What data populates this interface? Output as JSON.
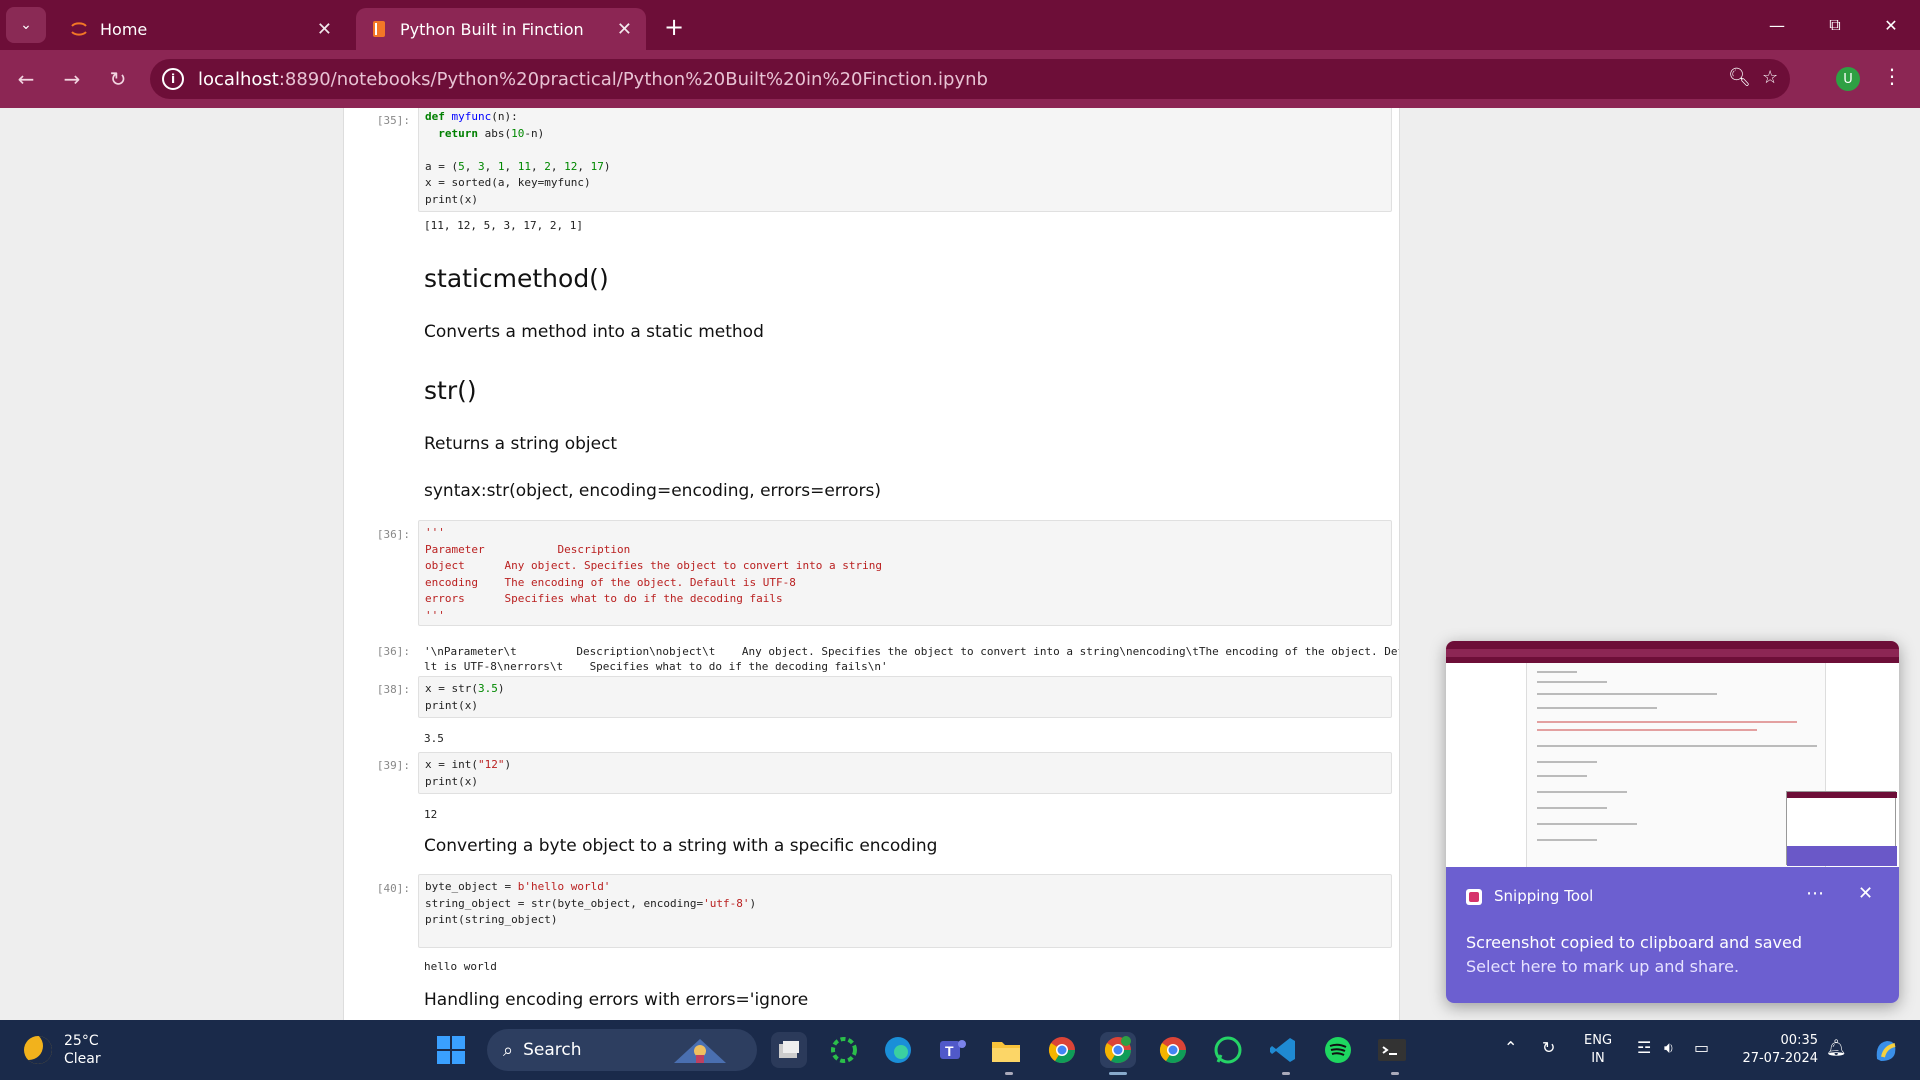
{
  "browser": {
    "tabs": [
      {
        "label": "Home",
        "active": false
      },
      {
        "label": "Python Built in Finction",
        "active": true
      }
    ],
    "new_tab": "+",
    "url_host": "localhost",
    "url_rest": ":8890/notebooks/Python%20practical/Python%20Built%20in%20Finction.ipynb",
    "profile_initial": "U",
    "theme_color": "#6d0e38",
    "accent_color": "#8c2654"
  },
  "notebook": {
    "cell35": {
      "prompt": "[35]:",
      "code_lines": [
        "def myfunc(n):",
        "  return abs(10-n)",
        "",
        "a = (5, 3, 1, 11, 2, 12, 17)",
        "x = sorted(a, key=myfunc)",
        "print(x)"
      ],
      "output": "[11, 12, 5, 3, 17, 2, 1]"
    },
    "h_staticmethod": "staticmethod()",
    "p_staticmethod": "Converts a method into a static method",
    "h_str": "str()",
    "p_str": "Returns a string object",
    "p_syntax": "syntax:str(object, encoding=encoding, errors=errors)",
    "cell36": {
      "prompt": "[36]:",
      "code_lines": [
        "'''",
        "Parameter           Description",
        "object      Any object. Specifies the object to convert into a string",
        "encoding    The encoding of the object. Default is UTF-8",
        "errors      Specifies what to do if the decoding fails",
        "'''"
      ],
      "out_prompt": "[36]:",
      "output_lines": [
        "'\\nParameter\\t         Description\\nobject\\t    Any object. Specifies the object to convert into a string\\nencoding\\tThe encoding of the object. Defau",
        "lt is UTF-8\\nerrors\\t    Specifies what to do if the decoding fails\\n'"
      ]
    },
    "cell38": {
      "prompt": "[38]:",
      "code_lines": [
        "x = str(3.5)",
        "print(x)"
      ],
      "output": "3.5"
    },
    "cell39": {
      "prompt": "[39]:",
      "code_lines": [
        "x = int(\"12\")",
        "print(x)"
      ],
      "output": "12"
    },
    "p_converting": "Converting a byte object to a string with a specific encoding",
    "cell40": {
      "prompt": "[40]:",
      "code_lines": [
        "byte_object = b'hello world'",
        "string_object = str(byte_object, encoding='utf-8')",
        "print(string_object)"
      ],
      "output": "hello world"
    },
    "p_handling": "Handling encoding errors with errors='ignore"
  },
  "toast": {
    "app": "Snipping Tool",
    "more": "⋯",
    "close": "✕",
    "message": "Screenshot copied to clipboard and saved",
    "sub": "Select here to mark up and share.",
    "color": "#6c5fd0"
  },
  "taskbar": {
    "temp": "25°C",
    "condition": "Clear",
    "search_label": "Search",
    "lang_top": "ENG",
    "lang_bottom": "IN",
    "time": "00:35",
    "date": "27-07-2024",
    "apps": [
      "file-explorer-icon",
      "copilot-icon",
      "edge-icon",
      "teams-icon",
      "folder-icon",
      "chrome-icon",
      "chrome-profile-icon",
      "chrome-alt-icon",
      "whatsapp-icon",
      "vscode-icon",
      "spotify-icon",
      "terminal-icon"
    ]
  }
}
